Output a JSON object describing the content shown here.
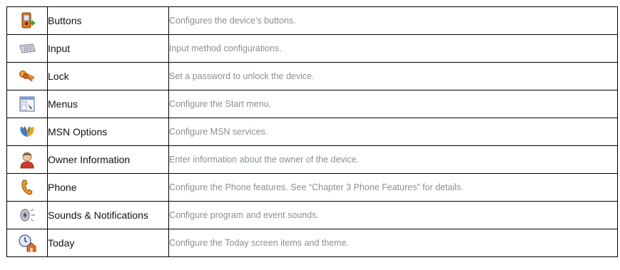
{
  "rows": [
    {
      "icon": "device-buttons-icon",
      "name": "Buttons",
      "description": "Configures the device’s buttons."
    },
    {
      "icon": "keyboard-icon",
      "name": "Input",
      "description": "Input method configurations."
    },
    {
      "icon": "keys-lock-icon",
      "name": "Lock",
      "description": "Set a password to unlock the device."
    },
    {
      "icon": "menu-window-icon",
      "name": "Menus",
      "description": "Configure the Start menu."
    },
    {
      "icon": "msn-butterfly-icon",
      "name": "MSN Options",
      "description": "Configure MSN services."
    },
    {
      "icon": "owner-person-icon",
      "name": "Owner Information",
      "description": "Enter information about the owner of the device."
    },
    {
      "icon": "phone-handset-icon",
      "name": "Phone",
      "description": "Configure the Phone features. See “Chapter 3 Phone Features” for details."
    },
    {
      "icon": "speaker-sound-icon",
      "name": "Sounds & Notifications",
      "description": "Configure program and event sounds."
    },
    {
      "icon": "today-clock-home-icon",
      "name": "Today",
      "description": "Configure the Today screen items and theme."
    }
  ]
}
